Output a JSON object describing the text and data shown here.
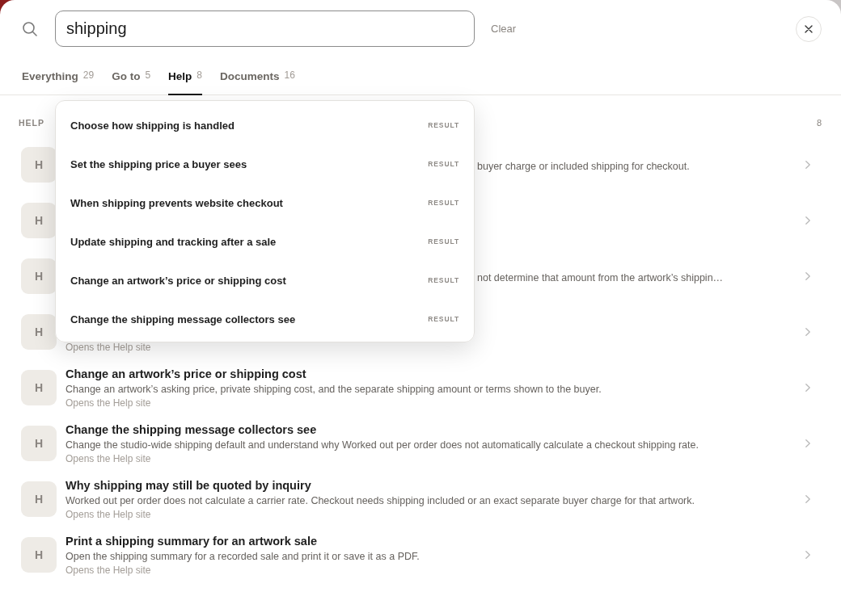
{
  "search": {
    "value": "shipping",
    "clear_label": "Clear"
  },
  "tabs": [
    {
      "label": "Everything",
      "count": "29",
      "selected": false
    },
    {
      "label": "Go to",
      "count": "5",
      "selected": false
    },
    {
      "label": "Help",
      "count": "8",
      "selected": true
    },
    {
      "label": "Documents",
      "count": "16",
      "selected": false
    }
  ],
  "section": {
    "title": "HELP",
    "count": "8"
  },
  "rows": [
    {
      "icon_letter": "H",
      "description_tail": "buyer charge or included shipping for checkout."
    },
    {
      "icon_letter": "H"
    },
    {
      "icon_letter": "H",
      "description_tail": "not determine that amount from the artwork’s shippin…"
    },
    {
      "icon_letter": "H",
      "subtitle": "Opens the Help site"
    },
    {
      "icon_letter": "H",
      "title": "Change an artwork’s price or shipping cost",
      "description": "Change an artwork’s asking price, private shipping cost, and the separate shipping amount or terms shown to the buyer.",
      "subtitle": "Opens the Help site"
    },
    {
      "icon_letter": "H",
      "title": "Change the shipping message collectors see",
      "description": "Change the studio-wide shipping default and understand why Worked out per order does not automatically calculate a checkout shipping rate.",
      "subtitle": "Opens the Help site"
    },
    {
      "icon_letter": "H",
      "title": "Why shipping may still be quoted by inquiry",
      "description": "Worked out per order does not calculate a carrier rate. Checkout needs shipping included or an exact separate buyer charge for that artwork.",
      "subtitle": "Opens the Help site"
    },
    {
      "icon_letter": "H",
      "title": "Print a shipping summary for an artwork sale",
      "description": "Open the shipping summary for a recorded sale and print it or save it as a PDF.",
      "subtitle": "Opens the Help site"
    }
  ],
  "suggestions": [
    {
      "title": "Choose how shipping is handled",
      "tag": "RESULT"
    },
    {
      "title": "Set the shipping price a buyer sees",
      "tag": "RESULT"
    },
    {
      "title": "When shipping prevents website checkout",
      "tag": "RESULT"
    },
    {
      "title": "Update shipping and tracking after a sale",
      "tag": "RESULT"
    },
    {
      "title": "Change an artwork’s price or shipping cost",
      "tag": "RESULT"
    },
    {
      "title": "Change the shipping message collectors see",
      "tag": "RESULT"
    }
  ]
}
